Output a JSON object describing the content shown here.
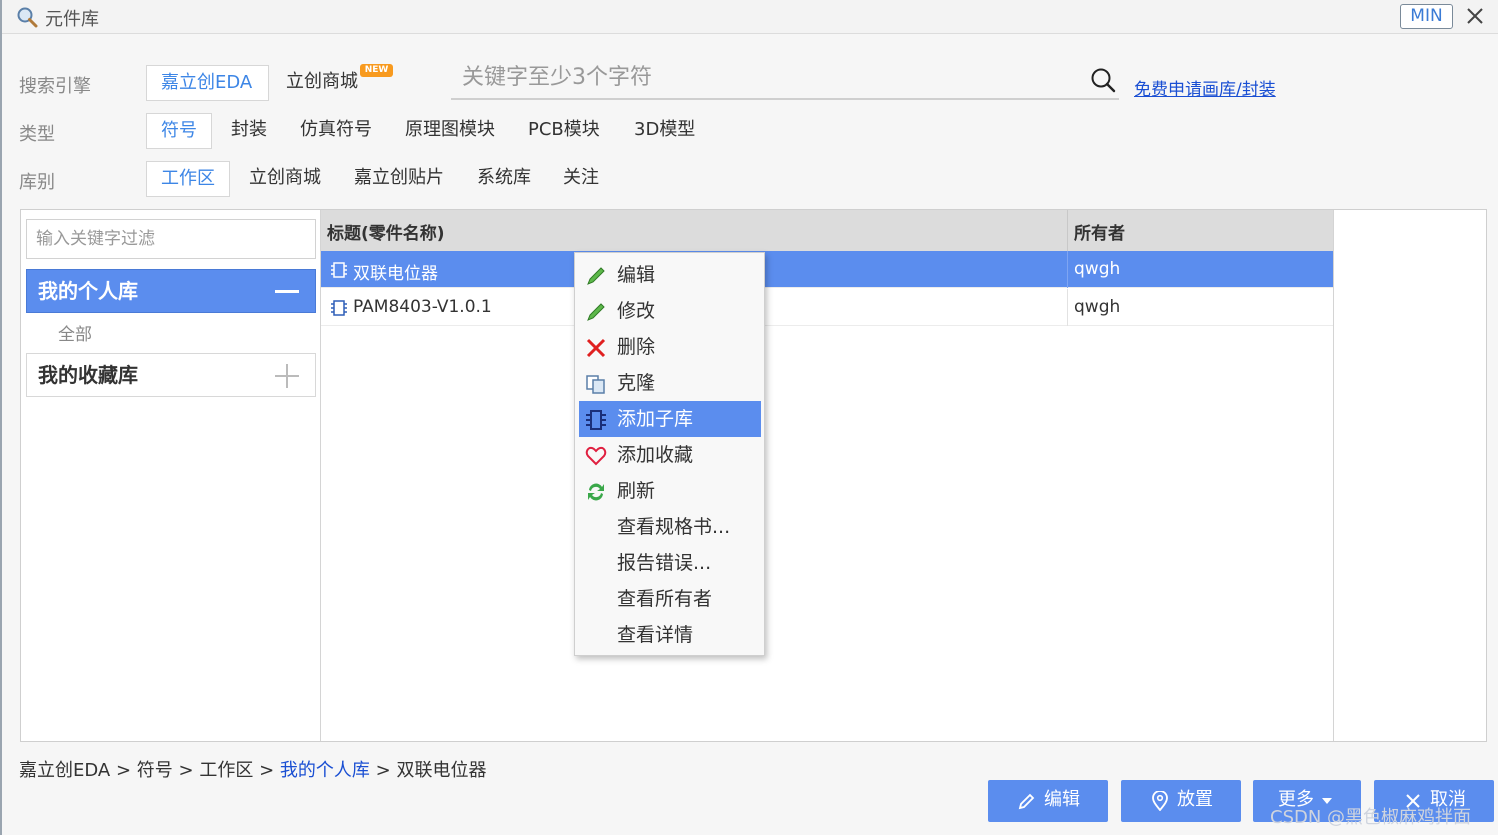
{
  "window": {
    "title": "元件库",
    "min_label": "MIN"
  },
  "filters": {
    "engine": {
      "label": "搜索引擎",
      "options": [
        "嘉立创EDA",
        "立创商城"
      ],
      "selected": "嘉立创EDA",
      "badge": "NEW"
    },
    "type": {
      "label": "类型",
      "options": [
        "符号",
        "封装",
        "仿真符号",
        "原理图模块",
        "PCB模块",
        "3D模型"
      ],
      "selected": "符号"
    },
    "library": {
      "label": "库别",
      "options": [
        "工作区",
        "立创商城",
        "嘉立创贴片",
        "系统库",
        "关注"
      ],
      "selected": "工作区"
    }
  },
  "search": {
    "placeholder": "关键字至少3个字符",
    "link": "免费申请画库/封装"
  },
  "sidebar": {
    "filter_placeholder": "输入关键字过滤",
    "personal_lib": "我的个人库",
    "all_label": "全部",
    "fav_lib": "我的收藏库"
  },
  "table": {
    "headers": [
      "标题(零件名称)",
      "所有者"
    ],
    "rows": [
      {
        "title": "双联电位器",
        "owner": "qwgh",
        "selected": true
      },
      {
        "title": "PAM8403-V1.0.1",
        "owner": "qwgh",
        "selected": false
      }
    ]
  },
  "context_menu": {
    "items": [
      {
        "label": "编辑",
        "icon": "pencil-icon"
      },
      {
        "label": "修改",
        "icon": "pencil-icon"
      },
      {
        "label": "删除",
        "icon": "red-x-icon"
      },
      {
        "label": "克隆",
        "icon": "copy-icon"
      },
      {
        "label": "添加子库",
        "icon": "chip-icon",
        "highlighted": true
      },
      {
        "label": "添加收藏",
        "icon": "heart-icon"
      },
      {
        "label": "刷新",
        "icon": "refresh-icon"
      },
      {
        "label": "查看规格书...",
        "icon": ""
      },
      {
        "label": "报告错误...",
        "icon": ""
      },
      {
        "label": "查看所有者",
        "icon": ""
      },
      {
        "label": "查看详情",
        "icon": ""
      }
    ]
  },
  "breadcrumb": {
    "parts": [
      "嘉立创EDA",
      "符号",
      "工作区",
      "我的个人库",
      "双联电位器"
    ],
    "separator": ">"
  },
  "footer_buttons": {
    "edit": "编辑",
    "place": "放置",
    "more": "更多",
    "cancel": "取消"
  },
  "watermark": "CSDN @黑色椒麻鸡拌面",
  "colors": {
    "accent": "#5b8dee",
    "link": "#1a4fd3",
    "badge": "#f89a1e"
  }
}
